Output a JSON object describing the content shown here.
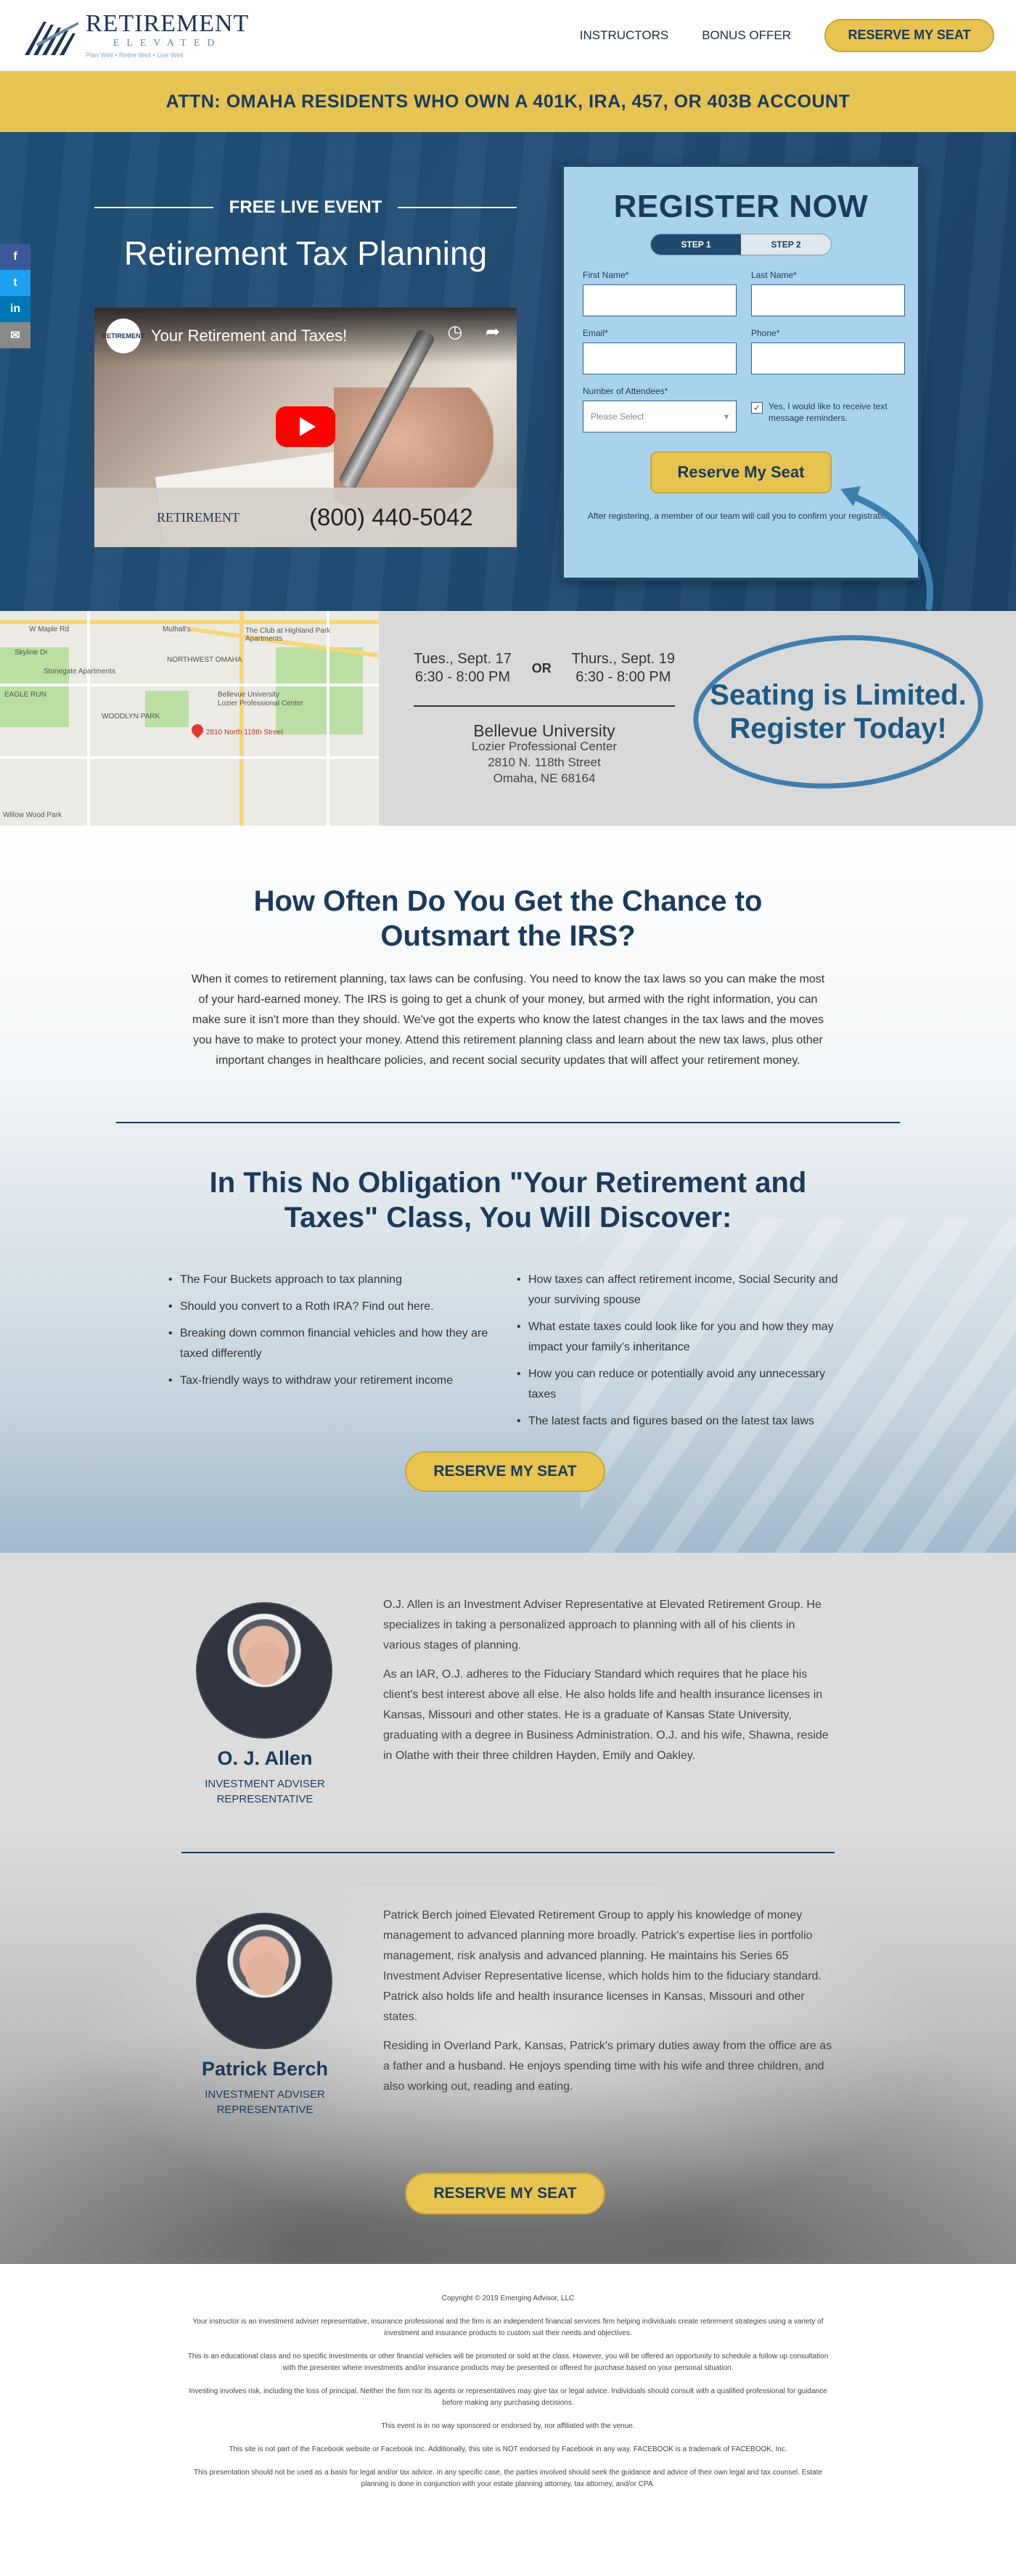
{
  "header": {
    "logo_title": "RETIREMENT",
    "logo_sub": "ELEVATED",
    "logo_tag": "Plan Well • Retire Well • Live Well",
    "nav": [
      "INSTRUCTORS",
      "BONUS OFFER"
    ],
    "cta": "RESERVE MY SEAT"
  },
  "attention": "ATTN: OMAHA RESIDENTS WHO OWN A 401K, IRA, 457, OR 403B ACCOUNT",
  "hero": {
    "eyebrow": "FREE LIVE EVENT",
    "title": "Retirement Tax Planning",
    "video": {
      "channel": "RETIREMENT",
      "title": "Your Retirement and Taxes!",
      "footer_logo": "RETIREMENT",
      "phone": "(800) 440-5042"
    }
  },
  "register": {
    "title": "REGISTER NOW",
    "step1": "STEP 1",
    "step2": "STEP 2",
    "first_name": "First Name*",
    "last_name": "Last Name*",
    "email": "Email*",
    "phone": "Phone*",
    "attendees": "Number of Attendees*",
    "attendees_placeholder": "Please Select",
    "sms_label": "Yes, I would like to receive text message reminders.",
    "button": "Reserve My Seat",
    "after": "After registering, a member of our team will call you to confirm your registration."
  },
  "share": [
    {
      "icon": "facebook-icon",
      "glyph": "f",
      "color": "#3b5998"
    },
    {
      "icon": "twitter-icon",
      "glyph": "t",
      "color": "#1da1f2"
    },
    {
      "icon": "linkedin-icon",
      "glyph": "in",
      "color": "#0077b5"
    },
    {
      "icon": "email-icon",
      "glyph": "✉",
      "color": "#888888"
    }
  ],
  "event": {
    "date1_day": "Tues., Sept. 17",
    "date1_time": "6:30 - 8:00 PM",
    "or": "OR",
    "date2_day": "Thurs., Sept. 19",
    "date2_time": "6:30 - 8:00 PM",
    "venue_name": "Bellevue University",
    "venue_sub": "Lozier Professional Center",
    "venue_street": "2810 N. 118th Street",
    "venue_city": "Omaha, NE 68164",
    "seating": "Seating is Limited. Register Today!"
  },
  "map_labels": [
    "NORTHWEST OMAHA",
    "WOODLYN PARK",
    "EAGLE RUN",
    "W Maple Rd",
    "Stonegate Apartments",
    "Skyline Dr",
    "The Club at Highland Park Apartments",
    "Mulhall's",
    "Bellevue University",
    "2810 North 118th Street",
    "Willow Wood Park",
    "Lozier Professional Center"
  ],
  "outsmart": {
    "title": "How Often Do You Get the Chance to Outsmart the IRS?",
    "body": "When it comes to retirement planning, tax laws can be confusing. You need to know the tax laws so you can make the most of your hard-earned money. The IRS is going to get a chunk of your money, but armed with the right information, you can make sure it isn't more than they should. We've got the experts who know the latest changes in the tax laws and the moves you have to make to protect your money. Attend this retirement planning class and learn about the new tax laws, plus other important changes in healthcare policies, and recent social security updates that will affect your retirement money.",
    "discover_title": "In This No Obligation \"Your Retirement and Taxes\" Class, You Will Discover:",
    "left_bullets": [
      "The Four Buckets approach to tax planning",
      "Should you convert to a Roth IRA? Find out here.",
      "Breaking down common financial vehicles and how they are taxed differently",
      "Tax-friendly ways to withdraw your retirement income"
    ],
    "right_bullets": [
      "How taxes can affect retirement income, Social Security and your surviving spouse",
      "What estate taxes could look like for you and how they may impact your family's inheritance",
      "How you can reduce or potentially avoid any unnecessary taxes",
      "The latest facts and figures based on the latest tax laws"
    ],
    "cta": "RESERVE MY SEAT"
  },
  "advisors": [
    {
      "name": "O. J. Allen",
      "title": "INVESTMENT ADVISER REPRESENTATIVE",
      "bio1": "O.J. Allen is an Investment Adviser Representative at Elevated Retirement Group. He specializes in taking a personalized approach to planning with all of his clients in various stages of planning.",
      "bio2": "As an IAR, O.J. adheres to the Fiduciary Standard which requires that he place his client's best interest above all else. He also holds life and health insurance licenses in Kansas, Missouri and other states. He is a graduate of Kansas State University, graduating with a degree in Business Administration. O.J. and his wife, Shawna, reside in Olathe with their three children Hayden, Emily and Oakley."
    },
    {
      "name": "Patrick Berch",
      "title": "INVESTMENT ADVISER REPRESENTATIVE",
      "bio1": "Patrick Berch joined Elevated Retirement Group to apply his knowledge of money management to advanced planning more broadly. Patrick's expertise lies in portfolio management, risk analysis and advanced planning. He maintains his Series 65 Investment Adviser Representative license, which holds him to the fiduciary standard. Patrick also holds life and health insurance licenses in Kansas, Missouri and other states.",
      "bio2": "Residing in Overland Park, Kansas, Patrick's primary duties away from the office are as a father and a husband. He enjoys spending time with his wife and three children, and also working out, reading and eating."
    }
  ],
  "advisors_cta": "RESERVE MY SEAT",
  "footer": [
    "Copyright © 2019 Emerging Advisor, LLC",
    "Your instructor is an investment adviser representative, insurance professional and the firm is an independent financial services firm helping individuals create retirement strategies using a variety of investment and insurance products to custom suit their needs and objectives.",
    "This is an educational class and no specific investments or other financial vehicles will be promoted or sold at the class. However, you will be offered an opportunity to schedule a follow up consultation with the presenter where investments and/or insurance products may be presented or offered for purchase based on your personal situation.",
    "Investing involves risk, including the loss of principal. Neither the firm nor its agents or representatives may give tax or legal advice. Individuals should consult with a qualified professional for guidance before making any purchasing decisions.",
    "This event is in no way sponsored or endorsed by, nor affiliated with the venue.",
    "This site is not part of the Facebook website or Facebook Inc. Additionally, this site is NOT endorsed by Facebook in any way. FACEBOOK is a trademark of FACEBOOK, Inc.",
    "This presentation should not be used as a basis for legal and/or tax advice. In any specific case, the parties involved should seek the guidance and advice of their own legal and tax counsel. Estate planning is done in conjunction with your estate planning attorney, tax attorney, and/or CPA."
  ],
  "colors": {
    "navy": "#1b3a5c",
    "gold": "#e7c44f",
    "form_bg": "#a8d3ec",
    "seating_blue": "#1d5a85"
  }
}
